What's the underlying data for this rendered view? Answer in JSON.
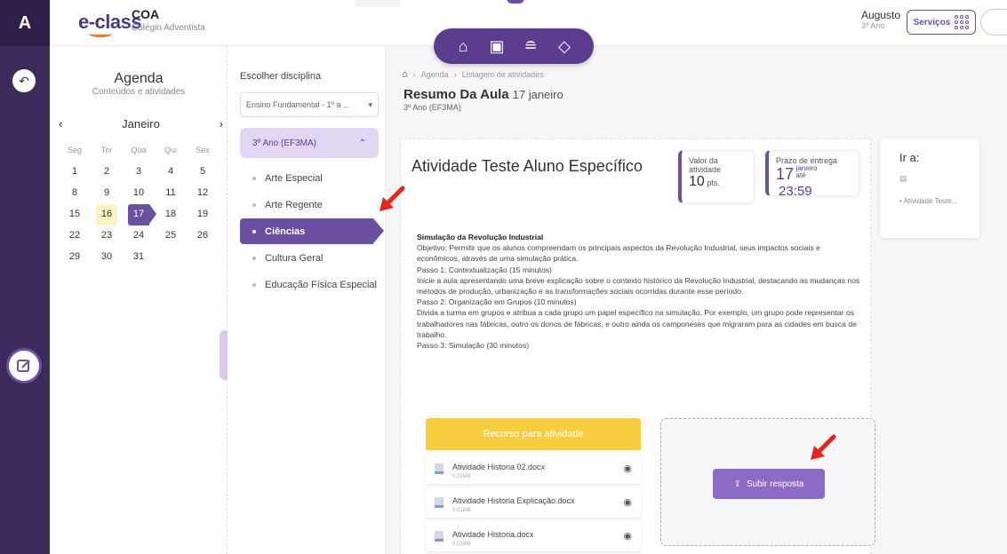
{
  "header": {
    "brand": "e-class",
    "school_short": "COA",
    "school_name": "Colégio Adventista",
    "user_name": "Augusto",
    "user_grade": "3º Ano",
    "services_label": "Serviços"
  },
  "rail": {
    "logo": "A"
  },
  "floatnav": {
    "items": [
      "home-icon",
      "classroom-icon",
      "graduation-icon",
      "tag-icon"
    ]
  },
  "agenda": {
    "title": "Agenda",
    "subtitle": "Conteúdos e atividades",
    "month": "Janeiro",
    "weekdays": [
      "Seg",
      "Ter",
      "Qua",
      "Qui",
      "Sex"
    ],
    "weeks": [
      [
        "1",
        "2",
        "3",
        "4",
        "5"
      ],
      [
        "8",
        "9",
        "10",
        "11",
        "12"
      ],
      [
        "15",
        "16",
        "17",
        "18",
        "19"
      ],
      [
        "22",
        "23",
        "24",
        "25",
        "26"
      ],
      [
        "29",
        "30",
        "31",
        "",
        ""
      ]
    ],
    "today": "16",
    "selected": "17"
  },
  "disciplines": {
    "label": "Escolher disciplina",
    "select_value": "Ensino Fundamental - 1º a ...",
    "group": "3º Ano (EF3MA)",
    "items": [
      "Arte Especial",
      "Arte Regente",
      "Ciências",
      "Cultura Geral",
      "Educação Física Especial"
    ],
    "active": "Ciências"
  },
  "breadcrumb": {
    "items": [
      "Agenda",
      "Listagem de atividades"
    ]
  },
  "lesson": {
    "title": "Resumo Da Aula",
    "date": "17 janeiro",
    "class": "3º Ano (EF3MA)"
  },
  "activity": {
    "title": "Atividade Teste Aluno Específico",
    "value_label_1": "Valor da",
    "value_label_2": "atividade",
    "value": "10",
    "value_unit": "pts.",
    "deadline_label": "Prazo de entrega",
    "deadline_day": "17",
    "deadline_month": "janeiro",
    "deadline_until": "até",
    "deadline_time": "23:59",
    "body": [
      "Simulação da Revolução Industrial",
      "Objetivo: Permitir que os alunos compreendam os principais aspectos da Revolução Industrial, seus impactos sociais e econômicos, através de uma simulação prática.",
      "Passo 1: Contextualização (15 minutos)",
      "Inicie a aula apresentando uma breve explicação sobre o contexto histórico da Revolução Industrial, destacando as mudanças nos métodos de produção, urbanização e as transformações sociais ocorridas durante esse período.",
      "Passo 2: Organização em Grupos (10 minutos)",
      "Divida a turma em grupos e atribua a cada grupo um papel específico na simulação. Por exemplo, um grupo pode representar os trabalhadores nas fábricas, outro os donos de fábricas, e outro ainda os camponeses que migraram para as cidades em busca de trabalho.",
      "Passo 3: Simulação (30 minutos)"
    ]
  },
  "resources": {
    "header": "Recurso para atividade",
    "files": [
      {
        "name": "Atividade Historia 02.docx",
        "size": "0,01MB"
      },
      {
        "name": "Atividade Historia Explicação.docx",
        "size": "0,01MB"
      },
      {
        "name": "Atividade Historia.docx",
        "size": "0,01MB"
      }
    ]
  },
  "upload": {
    "label": "Subir resposta"
  },
  "goto": {
    "title": "Ir a:",
    "link": "Atividade Teste..."
  },
  "colors": {
    "primary": "#6b4fa0",
    "rail": "#3b2a5a",
    "resource_header": "#f7cd3e",
    "arrow": "#e8231c"
  }
}
